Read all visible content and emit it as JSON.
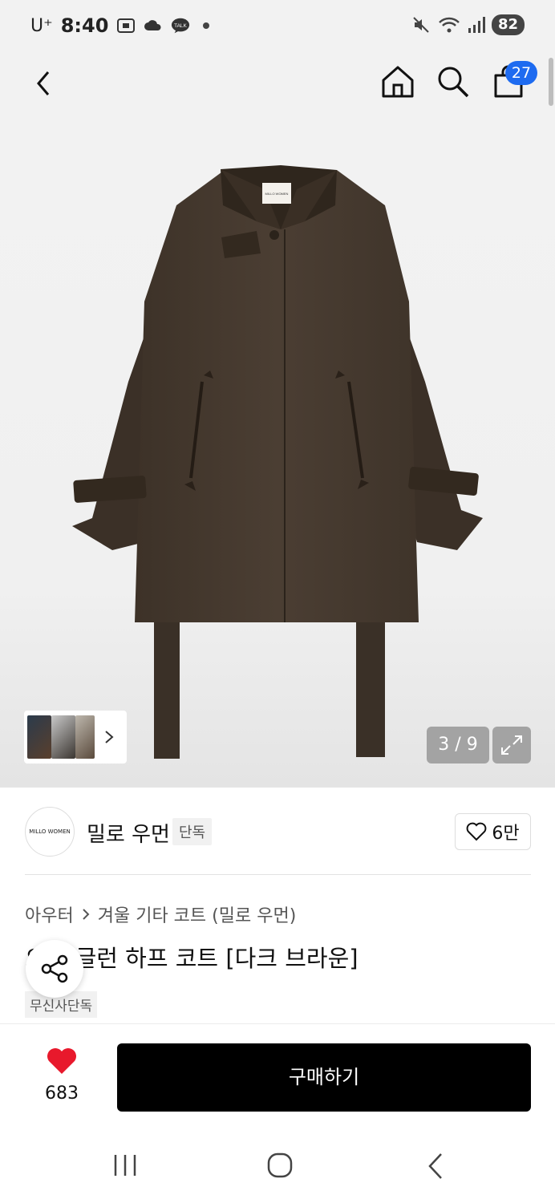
{
  "status_bar": {
    "carrier": "U⁺",
    "time": "8:40",
    "battery": "82",
    "icons": [
      "screenshot-icon",
      "cloud-icon",
      "kakaotalk-icon",
      "notification-dot-icon",
      "mute-icon",
      "wifi-icon",
      "signal-icon"
    ],
    "talk_label": "TALK"
  },
  "top_nav": {
    "cart_count": "27",
    "icons": [
      "back-icon",
      "home-icon",
      "search-icon",
      "cart-icon"
    ]
  },
  "gallery": {
    "counter": "3 / 9",
    "coat_label": "MILLO WOMEN"
  },
  "brand": {
    "logo_text": "MILLO WOMEN",
    "name": "밀로 우먼",
    "tag": "단독",
    "likes": "6만"
  },
  "product": {
    "breadcrumb": [
      "아우터",
      "겨울 기타 코트 (밀로 우먼)"
    ],
    "title": "오버 글런 하프 코트 [다크 브라운]",
    "exclusive_tag": "무신사단독"
  },
  "action": {
    "heart_count": "683",
    "buy_label": "구매하기"
  },
  "colors": {
    "accent_blue": "#1e6bf0",
    "heart_red": "#e8192c",
    "coat_brown": "#4a3d31",
    "buy_black": "#000000"
  }
}
